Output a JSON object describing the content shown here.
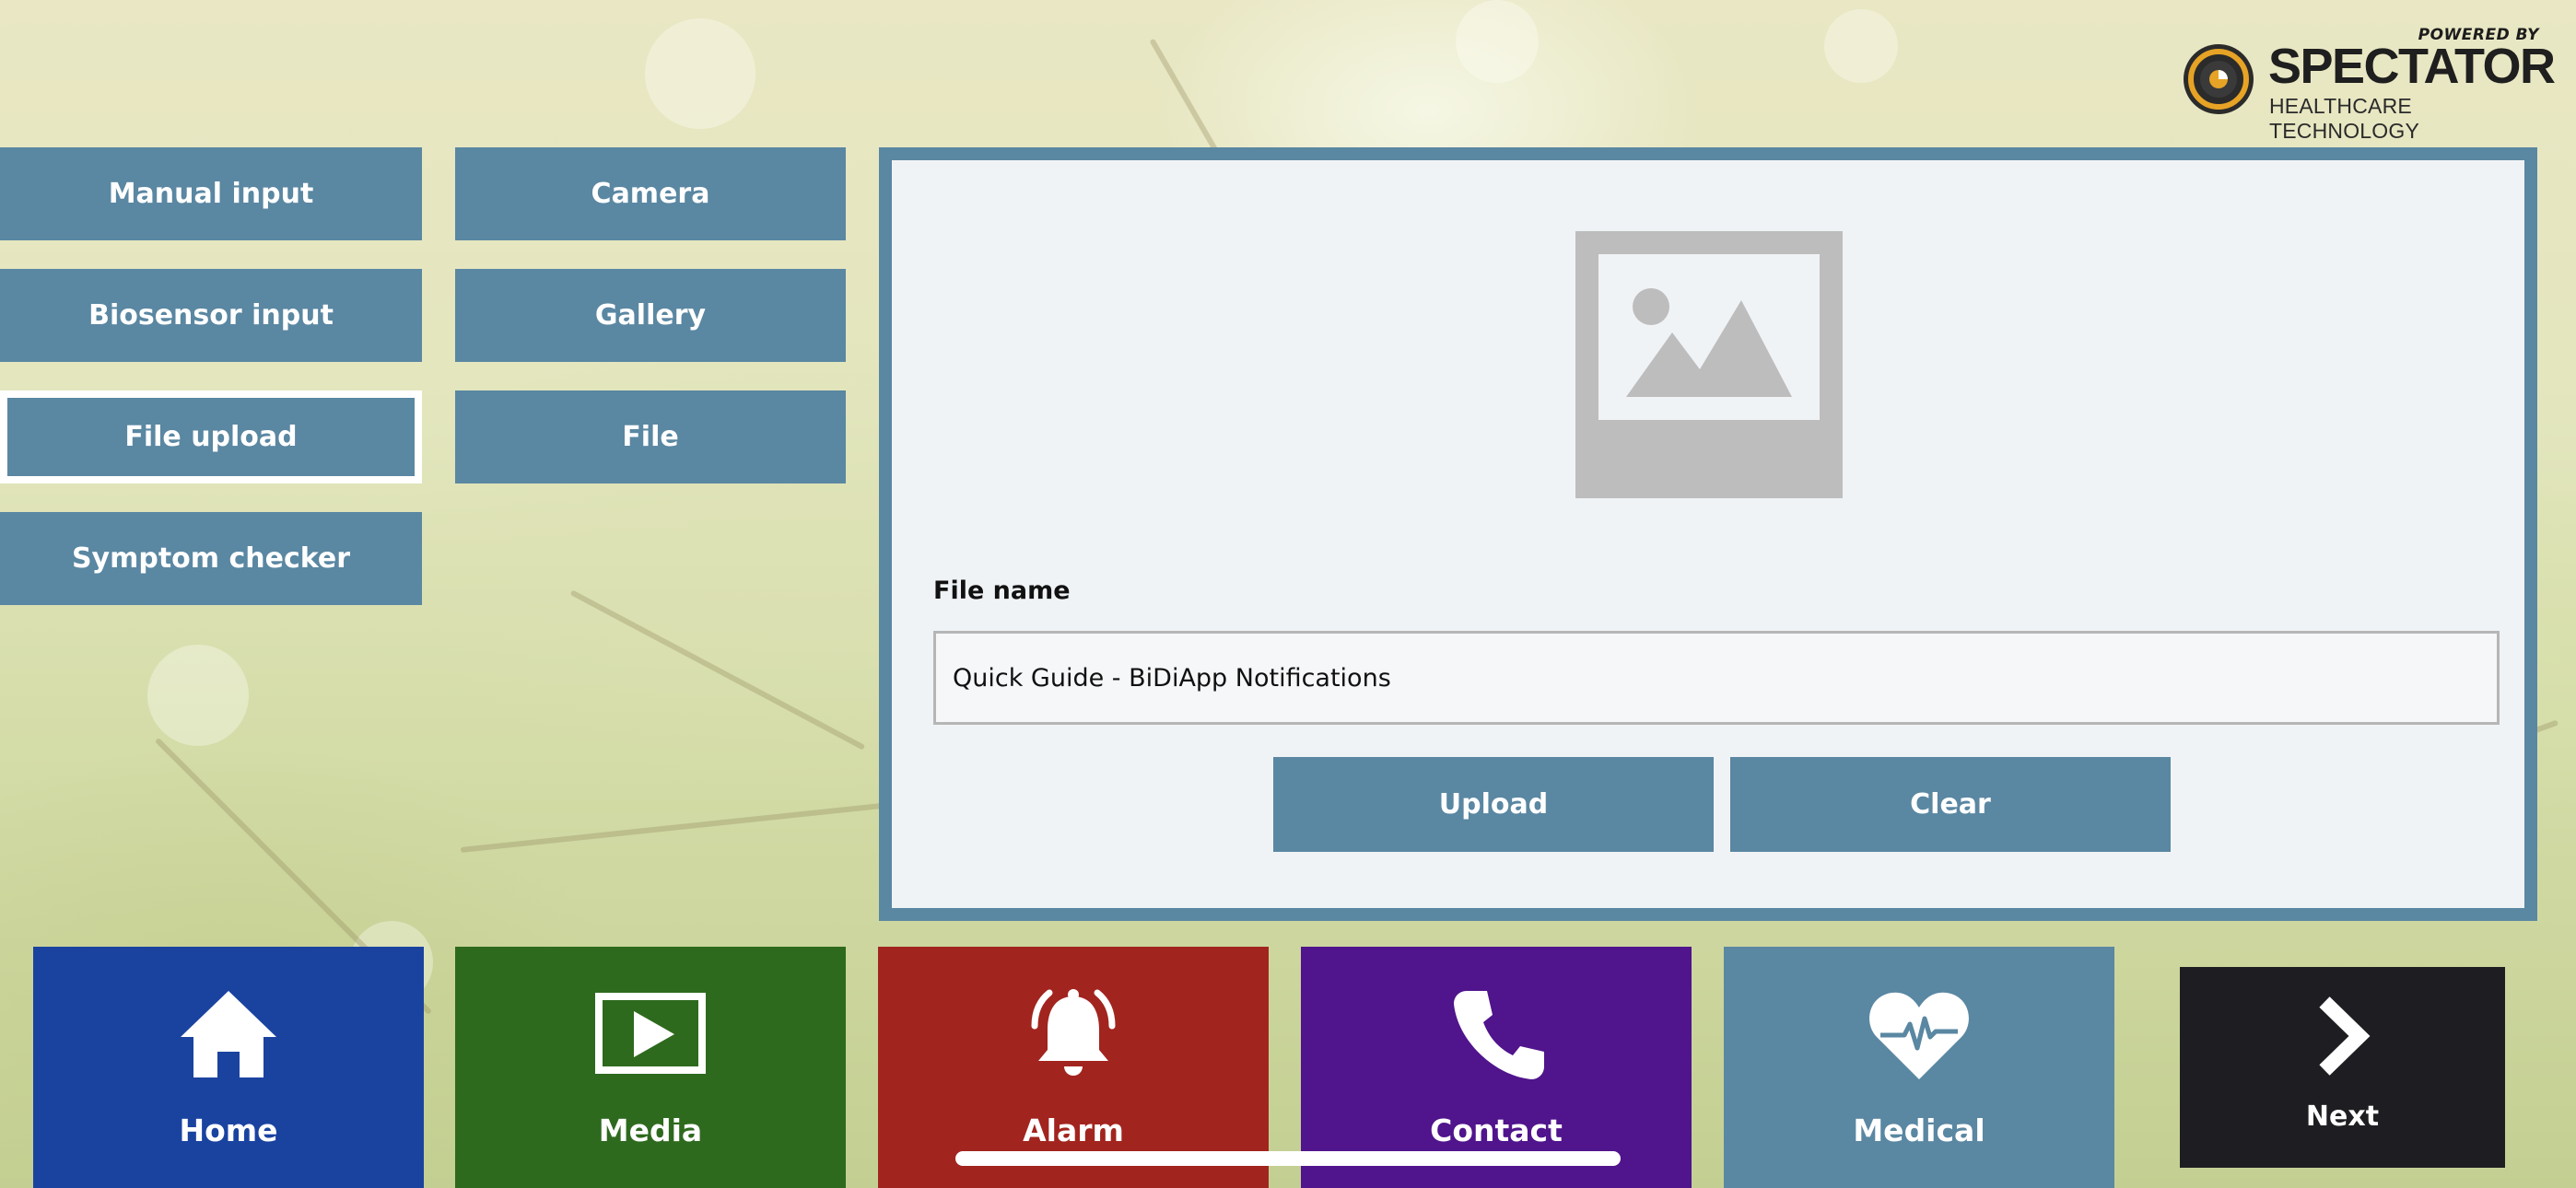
{
  "logo": {
    "powered_by": "POWERED BY",
    "brand": "SPECTATOR",
    "tagline": "HEALTHCARE TECHNOLOGY"
  },
  "input_methods": {
    "manual_input": "Manual input",
    "camera": "Camera",
    "biosensor_input": "Biosensor input",
    "gallery": "Gallery",
    "file_upload": "File upload",
    "file": "File",
    "symptom_checker": "Symptom checker",
    "selected": "File upload"
  },
  "panel": {
    "image_icon": "image-placeholder-icon",
    "file_name_label": "File name",
    "file_name_value": "Quick Guide - BiDiApp Notifications",
    "upload_label": "Upload",
    "clear_label": "Clear"
  },
  "nav": {
    "home": {
      "label": "Home",
      "icon": "home-icon",
      "color": "#1a43a0"
    },
    "media": {
      "label": "Media",
      "icon": "play-icon",
      "color": "#2e6a1e"
    },
    "alarm": {
      "label": "Alarm",
      "icon": "bell-icon",
      "color": "#a2241e"
    },
    "contact": {
      "label": "Contact",
      "icon": "phone-icon",
      "color": "#50148c"
    },
    "medical": {
      "label": "Medical",
      "icon": "heart-pulse-icon",
      "color": "#5a87a2"
    },
    "next": {
      "label": "Next",
      "icon": "chevron-right-icon",
      "color": "#1e1e22"
    }
  },
  "colors": {
    "accent": "#5a87a2",
    "panel_background": "#f0f3f6"
  }
}
